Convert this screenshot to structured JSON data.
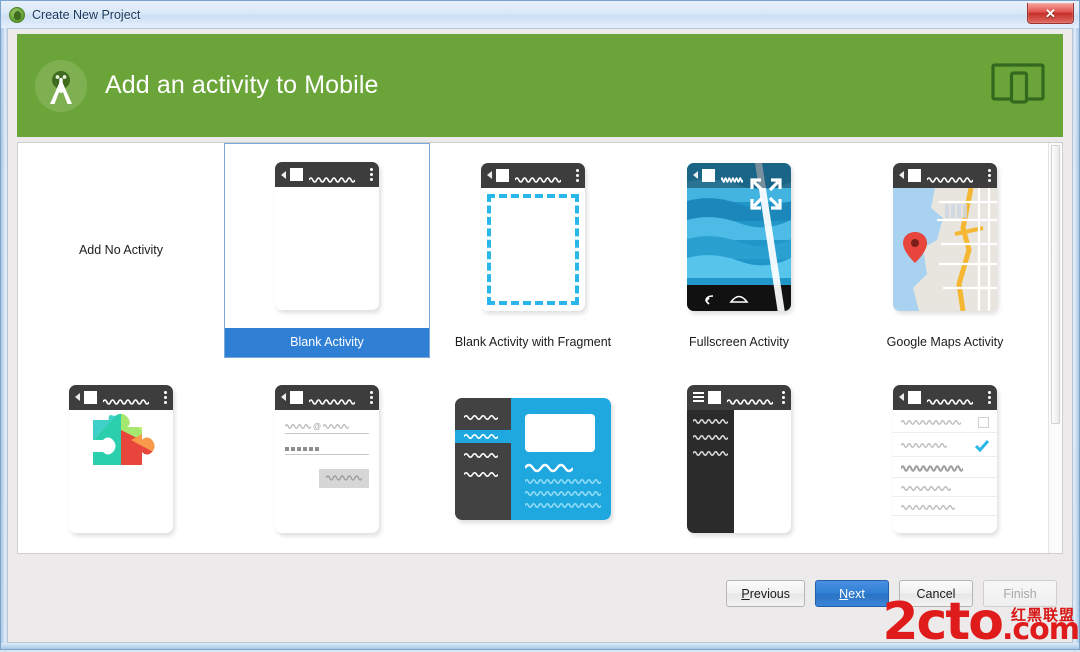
{
  "window": {
    "title": "Create New Project",
    "app_icon": "android-studio-icon",
    "close_label": "✕"
  },
  "header": {
    "title": "Add an activity to Mobile",
    "logo_icon": "android-studio-compass-icon",
    "device_icon": "tablet-phone-device-icon",
    "bg_color": "#6ba539"
  },
  "gallery": {
    "selected_index": 1,
    "tiles": [
      {
        "label": "Add No Activity",
        "art": "none",
        "name": "tile-add-no-activity"
      },
      {
        "label": "Blank Activity",
        "art": "blank",
        "name": "tile-blank-activity"
      },
      {
        "label": "Blank Activity with Fragment",
        "art": "fragment",
        "name": "tile-blank-activity-with-fragment"
      },
      {
        "label": "Fullscreen Activity",
        "art": "fullscreen",
        "name": "tile-fullscreen-activity"
      },
      {
        "label": "Google Maps Activity",
        "art": "maps",
        "name": "tile-google-maps-activity"
      },
      {
        "label": "",
        "art": "playservices",
        "name": "tile-google-play-services-activity"
      },
      {
        "label": "",
        "art": "login",
        "name": "tile-login-activity"
      },
      {
        "label": "",
        "art": "masterdetail",
        "name": "tile-master-detail-flow"
      },
      {
        "label": "",
        "art": "navdrawer",
        "name": "tile-navigation-drawer-activity"
      },
      {
        "label": "",
        "art": "settings",
        "name": "tile-settings-activity"
      }
    ]
  },
  "footer": {
    "previous": {
      "label": "Previous",
      "mnemonic": "P",
      "disabled": false
    },
    "next": {
      "label": "Next",
      "mnemonic": "N",
      "disabled": false,
      "primary": true
    },
    "cancel": {
      "label": "Cancel",
      "mnemonic": "",
      "disabled": false
    },
    "finish": {
      "label": "Finish",
      "mnemonic": "",
      "disabled": true
    }
  },
  "watermark": {
    "text": "2cto",
    "suffix": ".com",
    "cn": "红黑联盟",
    "color": "#e01b1b"
  },
  "colors": {
    "accent_green": "#6ba539",
    "selection_blue": "#2f7fd4",
    "appbar_dark": "#3d3d3d",
    "cyan": "#29b6e8"
  }
}
